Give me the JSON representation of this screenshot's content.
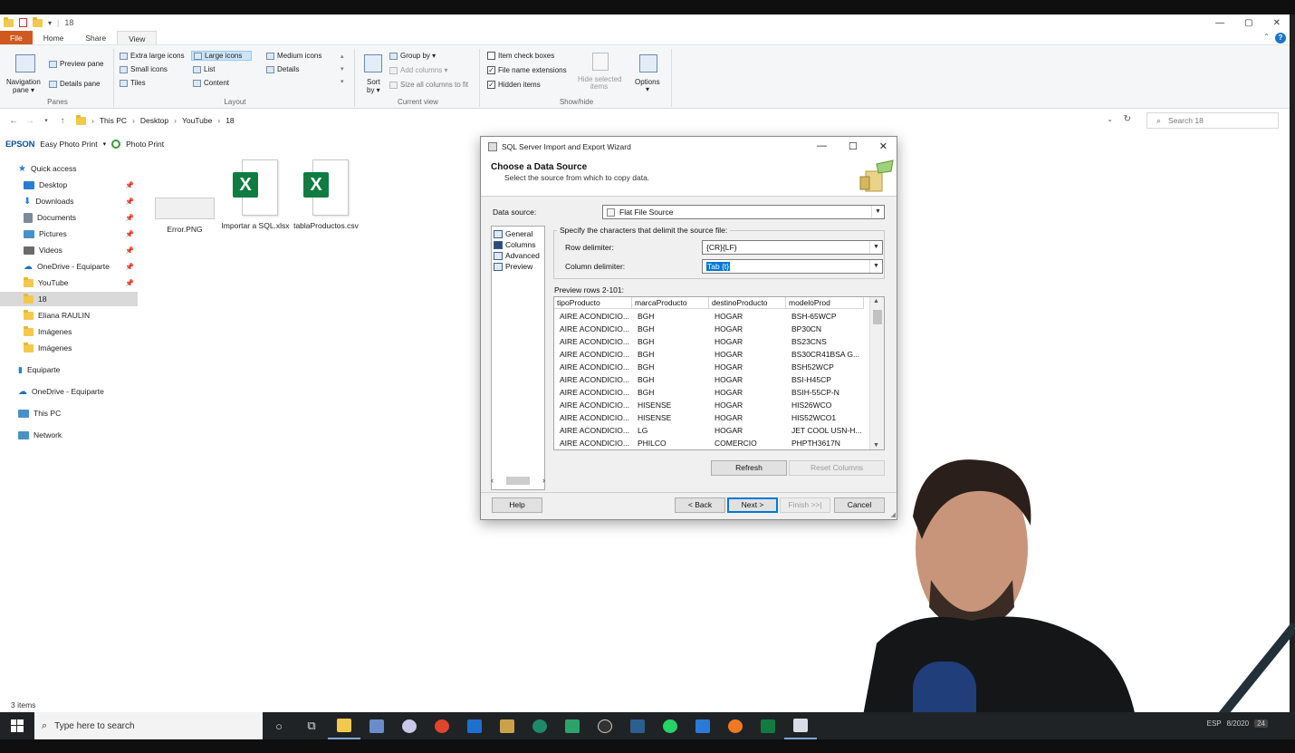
{
  "explorer": {
    "title": "18",
    "tabs": [
      "File",
      "Home",
      "Share",
      "View"
    ],
    "active_tab": "View",
    "ribbon": {
      "panes": {
        "navigation_pane": "Navigation",
        "navigation_pane_sub": "pane ▾",
        "preview_pane": "Preview pane",
        "details_pane": "Details pane",
        "group_label": "Panes"
      },
      "layout": {
        "items": [
          "Extra large icons",
          "Large icons",
          "Medium icons",
          "Small icons",
          "List",
          "Details",
          "Tiles",
          "Content"
        ],
        "selected": "Large icons",
        "group_label": "Layout"
      },
      "current_view": {
        "sort_by": "Sort",
        "sort_by_sub": "by ▾",
        "group_by": "Group by ▾",
        "add_columns": "Add columns ▾",
        "size_all": "Size all columns to fit",
        "group_label": "Current view"
      },
      "show_hide": {
        "item_check_boxes": "Item check boxes",
        "file_name_extensions": "File name extensions",
        "hidden_items": "Hidden items",
        "hide_selected": "Hide selected",
        "hide_selected_sub": "items",
        "options": "Options",
        "options_sub": "▾",
        "group_label": "Show/hide"
      }
    },
    "breadcrumb": [
      "This PC",
      "Desktop",
      "YouTube",
      "18"
    ],
    "search_placeholder": "Search 18",
    "epson_bar": {
      "brand": "EPSON",
      "app": "Easy Photo Print",
      "photo_print": "Photo Print"
    },
    "nav_items": [
      {
        "label": "Quick access",
        "color": "#2b7bd3"
      },
      {
        "label": "Desktop",
        "color": "#2b7bd3"
      },
      {
        "label": "Downloads",
        "color": "#2b7bd3"
      },
      {
        "label": "Documents",
        "color": "#7a8a99"
      },
      {
        "label": "Pictures",
        "color": "#4a90c8"
      },
      {
        "label": "Videos",
        "color": "#6a6a6a"
      },
      {
        "label": "OneDrive - Equiparte",
        "color": "#1e73c8"
      },
      {
        "label": "YouTube",
        "color": "#f2c94c"
      },
      {
        "label": "18",
        "color": "#f2c94c"
      },
      {
        "label": "Eliana RAULIN",
        "color": "#f2c94c"
      },
      {
        "label": "Imágenes",
        "color": "#f2c94c"
      },
      {
        "label": "Imágenes",
        "color": "#f2c94c"
      },
      {
        "label": "Equiparte",
        "color": "#2b7bd3"
      },
      {
        "label": "OneDrive - Equiparte",
        "color": "#1e73c8"
      },
      {
        "label": "This PC",
        "color": "#4a90c8"
      },
      {
        "label": "Network",
        "color": "#4a90c8"
      }
    ],
    "files": [
      {
        "name": "Error.PNG",
        "type": "png"
      },
      {
        "name": "Importar a SQL.xlsx",
        "type": "xlsx"
      },
      {
        "name": "tablaProductos.csv",
        "type": "csv"
      }
    ],
    "status": "3 items"
  },
  "wizard": {
    "title": "SQL Server Import and Export Wizard",
    "header_title": "Choose a Data Source",
    "header_sub": "Select the source from which to copy data.",
    "data_source_label": "Data source:",
    "data_source_value": "Flat File Source",
    "nav": [
      "General",
      "Columns",
      "Advanced",
      "Preview"
    ],
    "delimit_legend": "Specify the characters that delimit the source file:",
    "row_delimiter_label": "Row delimiter:",
    "row_delimiter_value": "{CR}{LF}",
    "column_delimiter_label": "Column delimiter:",
    "column_delimiter_value": "Tab {t}",
    "preview_label": "Preview rows 2-101:",
    "columns": [
      "tipoProducto",
      "marcaProducto",
      "destinoProducto",
      "modeloProd"
    ],
    "rows": [
      [
        "AIRE ACONDICIO...",
        "BGH",
        "HOGAR",
        "BSH-65WCP"
      ],
      [
        "AIRE ACONDICIO...",
        "BGH",
        "HOGAR",
        "BP30CN"
      ],
      [
        "AIRE ACONDICIO...",
        "BGH",
        "HOGAR",
        "BS23CNS"
      ],
      [
        "AIRE ACONDICIO...",
        "BGH",
        "HOGAR",
        "BS30CR41BSA G..."
      ],
      [
        "AIRE ACONDICIO...",
        "BGH",
        "HOGAR",
        "BSH52WCP"
      ],
      [
        "AIRE ACONDICIO...",
        "BGH",
        "HOGAR",
        "BSI-H45CP"
      ],
      [
        "AIRE ACONDICIO...",
        "BGH",
        "HOGAR",
        "BSIH-55CP-N"
      ],
      [
        "AIRE ACONDICIO...",
        "HISENSE",
        "HOGAR",
        "HIS26WCO"
      ],
      [
        "AIRE ACONDICIO...",
        "HISENSE",
        "HOGAR",
        "HIS52WCO1"
      ],
      [
        "AIRE ACONDICIO...",
        "LG",
        "HOGAR",
        "JET COOL USN-H..."
      ],
      [
        "AIRE ACONDICIO...",
        "PHILCO",
        "COMERCIO",
        "PHPTH3617N"
      ]
    ],
    "buttons": {
      "refresh": "Refresh",
      "reset_columns": "Reset Columns",
      "help": "Help",
      "back": "< Back",
      "next": "Next >",
      "finish": "Finish >>|",
      "cancel": "Cancel"
    }
  },
  "taskbar": {
    "search_placeholder": "Type here to search",
    "clock_date": "8/2020",
    "notification_count": "24",
    "lang": "ESP"
  }
}
